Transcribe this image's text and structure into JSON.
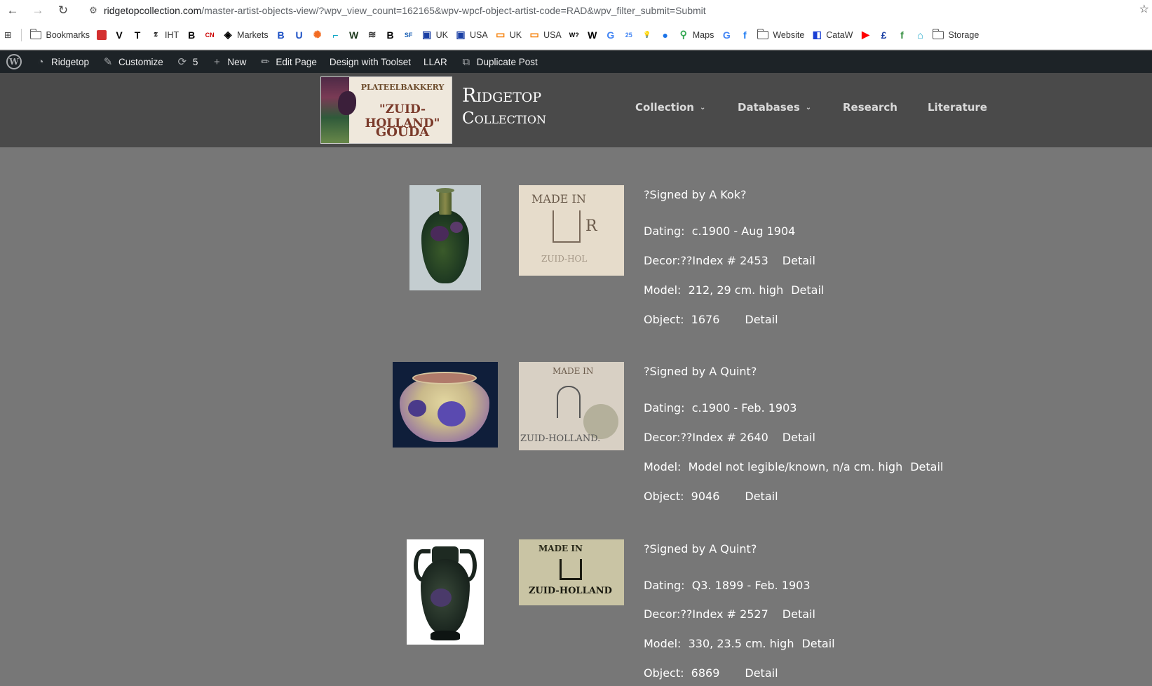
{
  "browser": {
    "url_host": "ridgetopcollection.com",
    "url_path": "/master-artist-objects-view/?wpv_view_count=162165&wpv-wpcf-object-artist-code=RAD&wpv_filter_submit=Submit"
  },
  "bookmarks": [
    {
      "label": "Bookmarks",
      "icon": "folder-icon"
    },
    {
      "label": "",
      "icon": "red-squares-icon",
      "color": "#d32f2f"
    },
    {
      "label": "",
      "icon": "v-icon",
      "color": "#000000",
      "glyph": "V"
    },
    {
      "label": "",
      "icon": "t-icon",
      "color": "#000000",
      "glyph": "T"
    },
    {
      "label": "IHT",
      "icon": "nyt-icon",
      "color": "#000000",
      "glyph": "𝕿"
    },
    {
      "label": "",
      "icon": "b-icon",
      "color": "#000000",
      "glyph": "B"
    },
    {
      "label": "",
      "icon": "cnn-icon",
      "color": "#cc0000",
      "glyph": "CN"
    },
    {
      "label": "Markets",
      "icon": "markets-icon",
      "color": "#000000",
      "glyph": "◈"
    },
    {
      "label": "",
      "icon": "b-blue-icon",
      "color": "#1a4fc4",
      "glyph": "B"
    },
    {
      "label": "",
      "icon": "shield-icon",
      "color": "#1a4fc4",
      "glyph": "U"
    },
    {
      "label": "",
      "icon": "sun-icon",
      "color": "#f26b21",
      "glyph": "✺"
    },
    {
      "label": "",
      "icon": "chart-icon",
      "color": "#0aa4c4",
      "glyph": "⌐"
    },
    {
      "label": "",
      "icon": "wl-icon",
      "color": "#1e3a1e",
      "glyph": "W"
    },
    {
      "label": "",
      "icon": "stripes-icon",
      "color": "#333333",
      "glyph": "≋"
    },
    {
      "label": "",
      "icon": "b-circle-icon",
      "color": "#000000",
      "glyph": "B"
    },
    {
      "label": "",
      "icon": "sf-icon",
      "color": "#1a5fb4",
      "glyph": "SF"
    },
    {
      "label": "UK",
      "icon": "gift-uk-icon",
      "color": "#1a3fa4",
      "glyph": "▣"
    },
    {
      "label": "USA",
      "icon": "gift-usa-icon",
      "color": "#1a3fa4",
      "glyph": "▣"
    },
    {
      "label": "UK",
      "icon": "orange-uk-icon",
      "color": "#f57c00",
      "glyph": "▭"
    },
    {
      "label": "USA",
      "icon": "orange-usa-icon",
      "color": "#f57c00",
      "glyph": "▭"
    },
    {
      "label": "",
      "icon": "w-question-icon",
      "color": "#000000",
      "glyph": "W?"
    },
    {
      "label": "",
      "icon": "wikipedia-icon",
      "color": "#000000",
      "glyph": "W"
    },
    {
      "label": "",
      "icon": "google-icon",
      "color": "#4285f4",
      "glyph": "G"
    },
    {
      "label": "",
      "icon": "calendar-icon",
      "color": "#4285f4",
      "glyph": "25"
    },
    {
      "label": "",
      "icon": "bulb-icon",
      "color": "#f4c20d",
      "glyph": "💡"
    },
    {
      "label": "",
      "icon": "person-icon",
      "color": "#1a73e8",
      "glyph": "●"
    },
    {
      "label": "Maps",
      "icon": "maps-icon",
      "color": "#34a853",
      "glyph": "⚲"
    },
    {
      "label": "",
      "icon": "translate-icon",
      "color": "#4285f4",
      "glyph": "G"
    },
    {
      "label": "",
      "icon": "facebook-icon",
      "color": "#1877f2",
      "glyph": "f"
    },
    {
      "label": "Website",
      "icon": "folder-icon"
    },
    {
      "label": "CataW",
      "icon": "cataw-icon",
      "color": "#1a3fd4",
      "glyph": "◧"
    },
    {
      "label": "",
      "icon": "youtube-icon",
      "color": "#ff0000",
      "glyph": "▶"
    },
    {
      "label": "",
      "icon": "pound-icon",
      "color": "#1a3fa4",
      "glyph": "£"
    },
    {
      "label": "",
      "icon": "t-green-icon",
      "color": "#2e8b3a",
      "glyph": "f"
    },
    {
      "label": "",
      "icon": "home-icon",
      "color": "#14a3c7",
      "glyph": "⌂"
    },
    {
      "label": "Storage",
      "icon": "folder-icon"
    }
  ],
  "adminbar": {
    "site": "Ridgetop",
    "customize": "Customize",
    "updates": "5",
    "new": "New",
    "edit_page": "Edit Page",
    "toolset": "Design with Toolset",
    "llar": "LLAR",
    "duplicate": "Duplicate Post"
  },
  "header": {
    "logo_line1": "PLATEELBAKKERY",
    "logo_line2": "\"ZUID-HOLLAND\"",
    "logo_line3": "GOUDA",
    "title_line1": "Ridgetop",
    "title_line2": "Collection",
    "nav": {
      "collection": "Collection",
      "databases": "Databases",
      "research": "Research",
      "literature": "Literature"
    }
  },
  "entries": [
    {
      "signed": "?Signed by A Kok?",
      "dating_label": "Dating:",
      "dating": "c.1900 - Aug 1904",
      "decor_label": "Decor:??Index #",
      "decor_index": "2453",
      "model_label": "Model:",
      "model": "212, 29 cm. high",
      "object_label": "Object:",
      "object": "1676",
      "detail": "Detail",
      "mark_text_top": "MADE IN",
      "mark_text_bottom": "ZUID-HOL"
    },
    {
      "signed": "?Signed by A Quint?",
      "dating_label": "Dating:",
      "dating": "c.1900 - Feb. 1903",
      "decor_label": "Decor:??Index #",
      "decor_index": "2640",
      "model_label": "Model:",
      "model": "Model not legible/known, n/a cm. high",
      "object_label": "Object:",
      "object": "9046",
      "detail": "Detail",
      "mark_text_top": "MADE IN",
      "mark_text_bottom": "ZUID-HOLLAND."
    },
    {
      "signed": "?Signed by A Quint?",
      "dating_label": "Dating:",
      "dating": "Q3. 1899 - Feb. 1903",
      "decor_label": "Decor:??Index #",
      "decor_index": "2527",
      "model_label": "Model:",
      "model": "330, 23.5 cm. high",
      "object_label": "Object:",
      "object": "6869",
      "detail": "Detail",
      "mark_text_top": "MADE IN",
      "mark_text_bottom": "ZUID-HOLLAND"
    }
  ]
}
